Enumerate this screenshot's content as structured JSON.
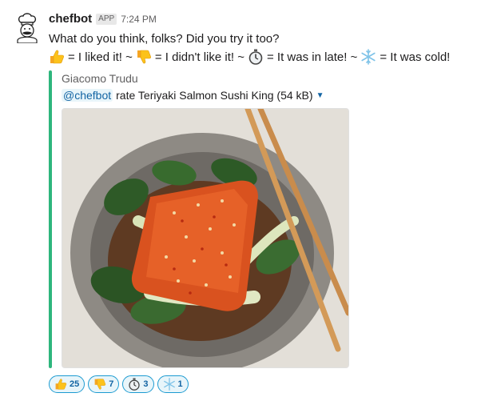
{
  "message": {
    "bot_name": "chefbot",
    "app_badge": "APP",
    "time": "7:24 PM",
    "text": "What do you think, folks? Did you try it too?",
    "legend": [
      {
        "icon": "thumbs-up-icon",
        "text": "= I liked it! ~"
      },
      {
        "icon": "thumbs-down-icon",
        "text": "= I didn't like it! ~"
      },
      {
        "icon": "stopwatch-icon",
        "text": "= It was in late! ~"
      },
      {
        "icon": "snowflake-icon",
        "text": "= It was cold!"
      }
    ]
  },
  "attachment": {
    "author": "Giacomo Trudu",
    "mention": "@chefbot",
    "title": "rate Teriyaki Salmon Sushi King (54 kB)",
    "accent_color": "#2eb67d"
  },
  "reactions": [
    {
      "icon": "thumbs-up-icon",
      "count": "25"
    },
    {
      "icon": "thumbs-down-icon",
      "count": "7"
    },
    {
      "icon": "stopwatch-icon",
      "count": "3"
    },
    {
      "icon": "snowflake-icon",
      "count": "1"
    }
  ]
}
